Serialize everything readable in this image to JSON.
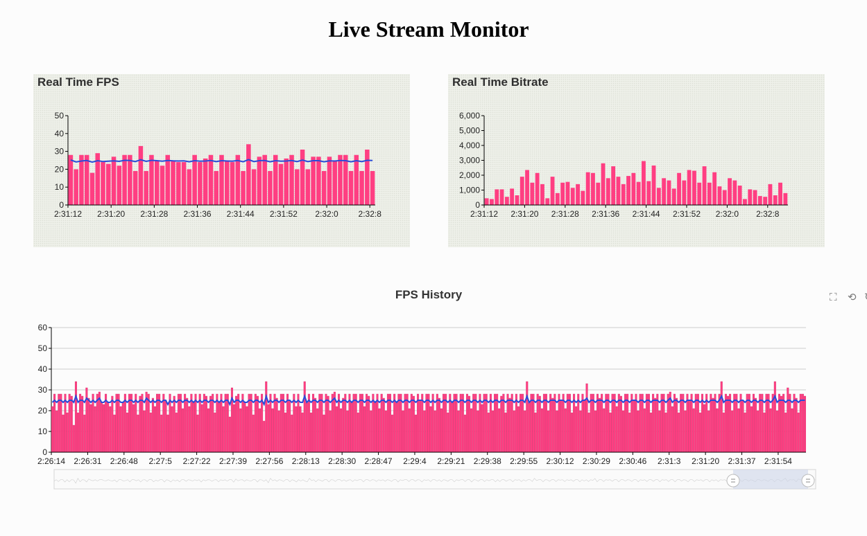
{
  "page": {
    "title": "Live Stream Monitor"
  },
  "colors": {
    "bar": "#ff3e82",
    "bar_stroke": "#d62d6a",
    "line": "#2a4bd8",
    "panel_bg": "#eef0e9",
    "grid": "#cccccc"
  },
  "toolbox": {
    "icons": [
      "zoom-select-icon",
      "zoom-reset-icon",
      "restore-icon"
    ]
  },
  "chart_data": [
    {
      "id": "fps",
      "title": "Real Time FPS",
      "type": "bar",
      "ylim": [
        0,
        50
      ],
      "yticks": [
        0,
        10,
        20,
        30,
        40,
        50
      ],
      "xtick_labels": [
        "2:31:12",
        "2:31:20",
        "2:31:28",
        "2:31:36",
        "2:31:44",
        "2:31:52",
        "2:32:0",
        "2:32:8"
      ],
      "xtick_step": 8,
      "values": [
        28,
        20,
        28,
        28,
        18,
        29,
        24,
        23,
        27,
        22,
        28,
        28,
        19,
        33,
        19,
        28,
        25,
        22,
        28,
        25,
        24,
        24,
        20,
        28,
        24,
        26,
        28,
        19,
        28,
        25,
        24,
        28,
        19,
        34,
        20,
        27,
        28,
        19,
        28,
        23,
        26,
        28,
        20,
        31,
        20,
        27,
        27,
        19,
        27,
        25,
        28,
        28,
        19,
        28,
        19,
        31,
        19
      ],
      "avg_values": [
        25.2,
        24.1,
        24.6,
        24.9,
        24.0,
        24.8,
        24.3,
        24.5,
        24.7,
        24.4,
        25.0,
        24.9,
        24.3,
        25.3,
        24.4,
        25.0,
        24.8,
        24.5,
        24.9,
        24.7,
        24.6,
        24.7,
        24.2,
        24.8,
        24.5,
        24.6,
        24.9,
        24.3,
        24.8,
        24.6,
        24.5,
        24.9,
        24.2,
        25.4,
        24.3,
        24.8,
        24.9,
        24.2,
        24.8,
        24.5,
        24.6,
        24.9,
        24.3,
        25.1,
        24.3,
        24.8,
        24.8,
        24.2,
        24.7,
        24.6,
        24.9,
        24.8,
        24.2,
        24.8,
        24.3,
        25.0,
        24.9
      ]
    },
    {
      "id": "bitrate",
      "title": "Real Time Bitrate",
      "type": "bar",
      "ylim": [
        0,
        6000
      ],
      "yticks": [
        0,
        1000,
        2000,
        3000,
        4000,
        5000,
        6000
      ],
      "ytick_labels": [
        "0",
        "1,000",
        "2,000",
        "3,000",
        "4,000",
        "5,000",
        "6,000"
      ],
      "xtick_labels": [
        "2:31:12",
        "2:31:20",
        "2:31:28",
        "2:31:36",
        "2:31:44",
        "2:31:52",
        "2:32:0",
        "2:32:8"
      ],
      "xtick_step": 8,
      "values": [
        450,
        400,
        1050,
        1050,
        550,
        1100,
        650,
        1900,
        2350,
        1500,
        2150,
        1400,
        450,
        1900,
        800,
        1500,
        1550,
        1150,
        1400,
        950,
        2200,
        2150,
        1500,
        2800,
        1800,
        2600,
        1900,
        1400,
        1950,
        2150,
        1550,
        2950,
        1600,
        2650,
        1150,
        1800,
        1650,
        1100,
        2150,
        1650,
        2350,
        2300,
        1500,
        2600,
        1500,
        2200,
        1250,
        1000,
        1800,
        1650,
        1300,
        400,
        1050,
        1000,
        600,
        550,
        1400,
        650,
        1500,
        800
      ]
    },
    {
      "id": "history",
      "title": "FPS History",
      "type": "bar",
      "ylim": [
        0,
        60
      ],
      "yticks": [
        0,
        10,
        20,
        30,
        40,
        50,
        60
      ],
      "xtick_labels": [
        "2:26:14",
        "2:26:31",
        "2:26:48",
        "2:27:5",
        "2:27:22",
        "2:27:39",
        "2:27:56",
        "2:28:13",
        "2:28:30",
        "2:28:47",
        "2:29:4",
        "2:29:21",
        "2:29:38",
        "2:29:55",
        "2:30:12",
        "2:30:29",
        "2:30:46",
        "2:31:3",
        "2:31:20",
        "2:31:37",
        "2:31:54"
      ],
      "xtick_step": 17,
      "values": [
        22,
        28,
        20,
        28,
        28,
        18,
        28,
        19,
        28,
        27,
        13,
        34,
        19,
        28,
        27,
        18,
        31,
        26,
        23,
        28,
        22,
        28,
        29,
        24,
        23,
        28,
        24,
        22,
        27,
        18,
        28,
        28,
        22,
        24,
        28,
        19,
        28,
        28,
        23,
        28,
        18,
        27,
        28,
        20,
        29,
        28,
        19,
        26,
        22,
        28,
        28,
        18,
        28,
        25,
        18,
        28,
        22,
        27,
        19,
        28,
        28,
        21,
        28,
        26,
        22,
        28,
        24,
        28,
        18,
        28,
        23,
        28,
        27,
        21,
        27,
        28,
        19,
        28,
        24,
        28,
        22,
        28,
        28,
        17,
        31,
        23,
        27,
        28,
        21,
        28,
        24,
        22,
        28,
        28,
        18,
        28,
        27,
        21,
        28,
        15,
        34,
        23,
        28,
        21,
        28,
        26,
        20,
        28,
        28,
        19,
        28,
        25,
        18,
        28,
        22,
        28,
        22,
        19,
        34,
        24,
        28,
        19,
        28,
        26,
        21,
        28,
        28,
        18,
        28,
        27,
        20,
        28,
        29,
        22,
        28,
        21,
        26,
        28,
        20,
        28,
        24,
        28,
        28,
        19,
        28,
        28,
        22,
        28,
        27,
        20,
        28,
        24,
        28,
        21,
        28,
        26,
        20,
        28,
        28,
        18,
        28,
        24,
        28,
        28,
        20,
        28,
        28,
        21,
        28,
        27,
        18,
        28,
        25,
        28,
        20,
        28,
        28,
        22,
        28,
        20,
        28,
        26,
        21,
        28,
        28,
        19,
        28,
        24,
        28,
        28,
        20,
        28,
        28,
        18,
        28,
        27,
        21,
        28,
        28,
        20,
        28,
        23,
        28,
        28,
        19,
        28,
        20,
        28,
        28,
        21,
        27,
        28,
        19,
        28,
        26,
        28,
        20,
        28,
        22,
        28,
        28,
        20,
        34,
        24,
        28,
        28,
        19,
        28,
        27,
        21,
        28,
        28,
        20,
        28,
        26,
        28,
        20,
        28,
        25,
        28,
        21,
        28,
        28,
        19,
        28,
        22,
        28,
        20,
        28,
        25,
        33,
        19,
        28,
        28,
        20,
        28,
        26,
        28,
        21,
        28,
        28,
        19,
        28,
        28,
        22,
        28,
        27,
        20,
        28,
        28,
        19,
        28,
        25,
        28,
        20,
        28,
        28,
        21,
        28,
        28,
        19,
        28,
        26,
        28,
        20,
        28,
        28,
        19,
        28,
        29,
        22,
        28,
        26,
        19,
        28,
        28,
        20,
        28,
        25,
        28,
        21,
        28,
        28,
        19,
        28,
        23,
        28,
        20,
        28,
        26,
        28,
        21,
        28,
        34,
        19,
        28,
        27,
        28,
        20,
        28,
        28,
        21,
        28,
        25,
        19,
        28,
        28,
        22,
        28,
        26,
        20,
        28,
        28,
        19,
        28,
        28,
        21,
        28,
        34,
        20,
        28,
        27,
        28,
        19,
        31,
        28,
        21,
        28,
        26,
        19,
        28,
        28,
        27
      ],
      "avg_values": [
        24,
        25,
        24,
        25,
        25,
        24,
        25,
        24,
        25,
        25,
        24,
        27,
        24,
        25,
        25,
        24,
        26,
        25,
        24,
        25,
        24,
        25,
        26,
        24,
        24,
        25,
        24,
        24,
        25,
        24,
        25,
        25,
        24,
        24,
        25,
        24,
        25,
        25,
        24,
        25,
        24,
        25,
        25,
        24,
        26,
        25,
        24,
        25,
        24,
        25,
        25,
        24,
        25,
        25,
        23,
        25,
        24,
        25,
        24,
        25,
        25,
        24,
        25,
        25,
        24,
        25,
        24,
        25,
        24,
        25,
        24,
        25,
        25,
        24,
        25,
        25,
        24,
        25,
        24,
        25,
        24,
        25,
        25,
        23,
        26,
        24,
        25,
        25,
        24,
        25,
        24,
        24,
        25,
        25,
        24,
        25,
        25,
        24,
        25,
        23,
        27,
        24,
        25,
        24,
        25,
        25,
        24,
        25,
        25,
        24,
        25,
        25,
        24,
        25,
        24,
        25,
        24,
        24,
        27,
        24,
        25,
        24,
        25,
        25,
        24,
        25,
        25,
        24,
        25,
        25,
        24,
        25,
        26,
        24,
        25,
        24,
        25,
        25,
        24,
        25,
        24,
        25,
        25,
        24,
        25,
        25,
        24,
        25,
        25,
        24,
        25,
        24,
        25,
        24,
        25,
        25,
        24,
        25,
        25,
        24,
        25,
        24,
        25,
        25,
        24,
        25,
        25,
        24,
        25,
        25,
        24,
        25,
        25,
        25,
        24,
        25,
        25,
        24,
        25,
        24,
        25,
        25,
        24,
        25,
        25,
        24,
        25,
        24,
        25,
        25,
        24,
        25,
        25,
        24,
        25,
        25,
        24,
        25,
        25,
        24,
        25,
        24,
        25,
        25,
        24,
        25,
        24,
        25,
        25,
        24,
        25,
        25,
        24,
        25,
        25,
        25,
        24,
        25,
        24,
        25,
        25,
        24,
        27,
        24,
        25,
        25,
        24,
        25,
        25,
        24,
        25,
        25,
        24,
        25,
        25,
        25,
        24,
        25,
        25,
        25,
        24,
        25,
        25,
        24,
        25,
        24,
        25,
        24,
        25,
        25,
        26,
        24,
        25,
        25,
        24,
        25,
        25,
        25,
        24,
        25,
        25,
        24,
        25,
        25,
        24,
        25,
        25,
        24,
        25,
        25,
        24,
        25,
        25,
        25,
        24,
        25,
        25,
        24,
        25,
        25,
        24,
        25,
        25,
        25,
        24,
        25,
        25,
        24,
        25,
        26,
        24,
        25,
        25,
        24,
        25,
        25,
        24,
        25,
        25,
        25,
        24,
        25,
        25,
        24,
        25,
        24,
        25,
        24,
        25,
        25,
        25,
        24,
        25,
        27,
        24,
        25,
        25,
        25,
        24,
        25,
        25,
        24,
        25,
        25,
        24,
        25,
        25,
        24,
        25,
        25,
        24,
        25,
        25,
        24,
        25,
        25,
        24,
        25,
        27,
        24,
        25,
        25,
        25,
        24,
        25,
        25,
        24,
        25,
        25,
        24,
        25,
        25,
        25
      ]
    }
  ]
}
